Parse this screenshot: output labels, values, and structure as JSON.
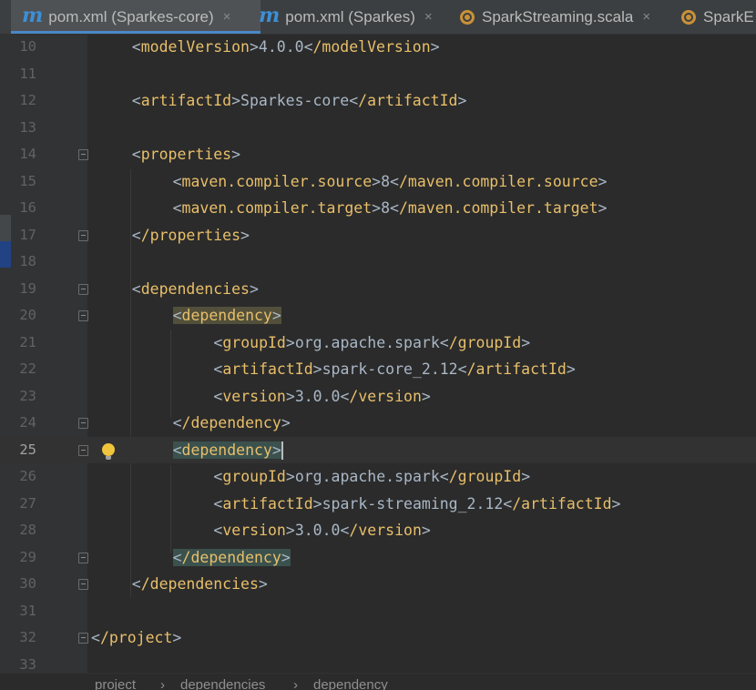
{
  "tabs": [
    {
      "label": "pom.xml (Sparkes-core)",
      "icon": "maven-icon",
      "active": true
    },
    {
      "label": "pom.xml (Sparkes)",
      "icon": "maven-icon",
      "active": false
    },
    {
      "label": "SparkStreaming.scala",
      "icon": "scala-object-icon",
      "active": false
    },
    {
      "label": "SparkE",
      "icon": "scala-object-icon",
      "active": false
    }
  ],
  "close_glyph": "×",
  "icon_glyphs": {
    "maven": "m"
  },
  "lines": [
    {
      "n": "10",
      "text": "<modelVersion>4.0.0</modelVersion>"
    },
    {
      "n": "11",
      "text": ""
    },
    {
      "n": "12",
      "text": "<artifactId>Sparkes-core</artifactId>"
    },
    {
      "n": "13",
      "text": ""
    },
    {
      "n": "14",
      "text": "<properties>"
    },
    {
      "n": "15",
      "text": "<maven.compiler.source>8</maven.compiler.source>"
    },
    {
      "n": "16",
      "text": "<maven.compiler.target>8</maven.compiler.target>"
    },
    {
      "n": "17",
      "text": "</properties>"
    },
    {
      "n": "18",
      "text": ""
    },
    {
      "n": "19",
      "text": "<dependencies>"
    },
    {
      "n": "20",
      "text": "<dependency>"
    },
    {
      "n": "21",
      "text": "<groupId>org.apache.spark</groupId>"
    },
    {
      "n": "22",
      "text": "<artifactId>spark-core_2.12</artifactId>"
    },
    {
      "n": "23",
      "text": "<version>3.0.0</version>"
    },
    {
      "n": "24",
      "text": "</dependency>"
    },
    {
      "n": "25",
      "text": "<dependency>"
    },
    {
      "n": "26",
      "text": "<groupId>org.apache.spark</groupId>"
    },
    {
      "n": "27",
      "text": "<artifactId>spark-streaming_2.12</artifactId>"
    },
    {
      "n": "28",
      "text": "<version>3.0.0</version>"
    },
    {
      "n": "29",
      "text": "</dependency>"
    },
    {
      "n": "30",
      "text": "</dependencies>"
    },
    {
      "n": "31",
      "text": ""
    },
    {
      "n": "32",
      "text": "</project>"
    },
    {
      "n": "33",
      "text": ""
    }
  ],
  "breadcrumb": [
    "project",
    "dependencies",
    "dependency"
  ],
  "colors": {
    "tag": "#e8bf6a",
    "text": "#a9b7c6",
    "background": "#2b2b2b",
    "gutter": "#313335"
  }
}
